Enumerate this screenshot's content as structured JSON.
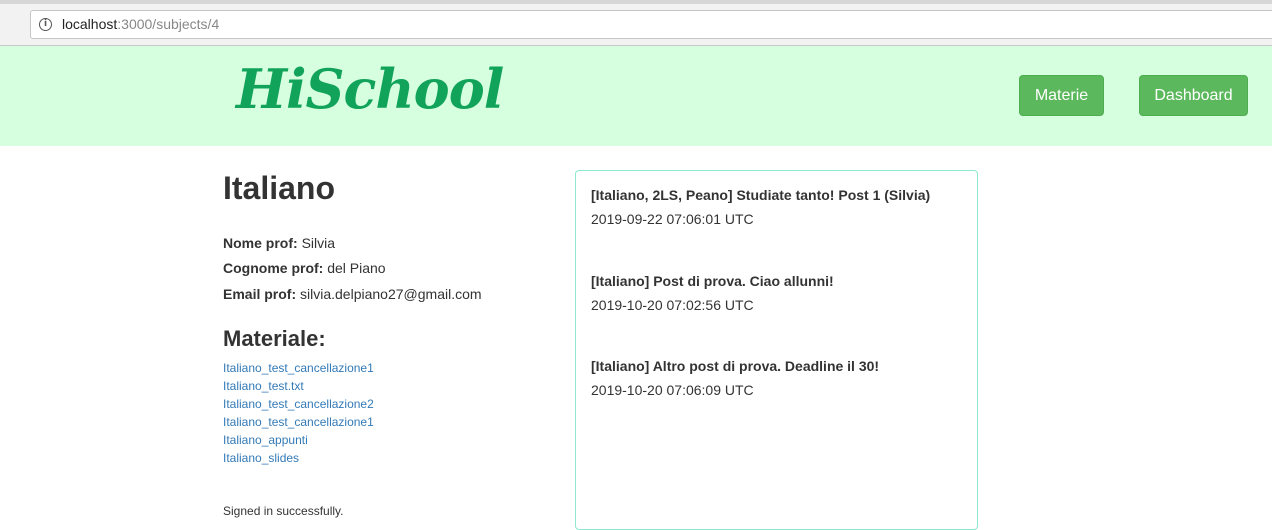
{
  "browser": {
    "url_host": "localhost",
    "url_path": ":3000/subjects/4",
    "info_icon": "info-circle-icon"
  },
  "navbar": {
    "logo": "HiSchool",
    "buttons": {
      "materie": "Materie",
      "dashboard": "Dashboard"
    },
    "colors": {
      "background": "#d5ffdf",
      "button": "#5cb85c",
      "logo": "#11a35a"
    }
  },
  "subject": {
    "title": "Italiano",
    "nome_label": "Nome prof:",
    "nome_value": "Silvia",
    "cognome_label": "Cognome prof:",
    "cognome_value": "del Piano",
    "email_label": "Email prof:",
    "email_value": "silvia.delpiano27@gmail.com"
  },
  "materials": {
    "title": "Materiale:",
    "items": [
      "Italiano_test_cancellazione1",
      "Italiano_test.txt",
      "Italiano_test_cancellazione2",
      "Italiano_test_cancellazione1",
      "Italiano_appunti",
      "Italiano_slides"
    ]
  },
  "posts": [
    {
      "title": "[Italiano, 2LS, Peano] Studiate tanto! Post 1 (Silvia)",
      "date": "2019-09-22 07:06:01 UTC"
    },
    {
      "title": "[Italiano] Post di prova. Ciao allunni!",
      "date": "2019-10-20 07:02:56 UTC"
    },
    {
      "title": "[Italiano] Altro post di prova. Deadline il 30!",
      "date": "2019-10-20 07:06:09 UTC"
    }
  ],
  "flash": "Signed in successfully."
}
